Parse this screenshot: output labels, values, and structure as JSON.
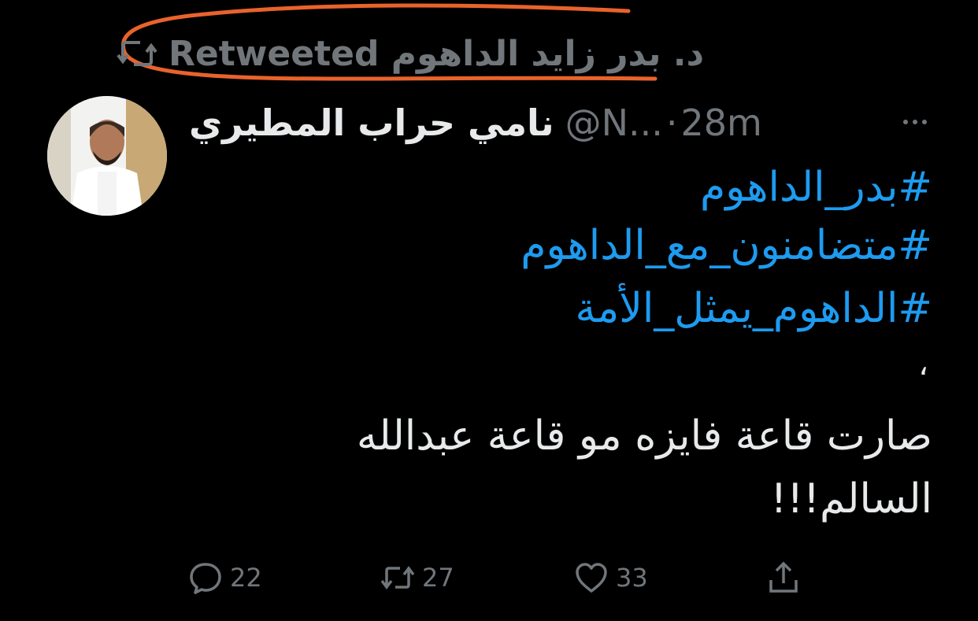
{
  "retweet_header": {
    "text": "د. بدر زايد الداهوم Retweeted",
    "icon": "retweet-icon",
    "annotation_color": "#e8632b"
  },
  "author": {
    "display_name": "نامي حراب المطيري",
    "handle": "@N...",
    "separator": "·",
    "time": "28m",
    "avatar": "avatar-photo"
  },
  "more_icon": "more-icon",
  "tweet": {
    "hashtags": [
      "#بدر_الداهوم",
      "#متضامنون_مع_الداهوم",
      "#الداهوم_يمثل_الأمة"
    ],
    "comma": "،",
    "lines": [
      "صارت قاعة فايزه مو قاعة عبدالله",
      "السالم!!!"
    ]
  },
  "actions": {
    "reply": {
      "icon": "reply-icon",
      "count": "22"
    },
    "retweet": {
      "icon": "retweet-icon",
      "count": "27"
    },
    "like": {
      "icon": "heart-icon",
      "count": "33"
    },
    "share": {
      "icon": "share-icon"
    }
  },
  "colors": {
    "background": "#000000",
    "text": "#e7e9ea",
    "muted": "#71767b",
    "link": "#1d9bf0"
  }
}
